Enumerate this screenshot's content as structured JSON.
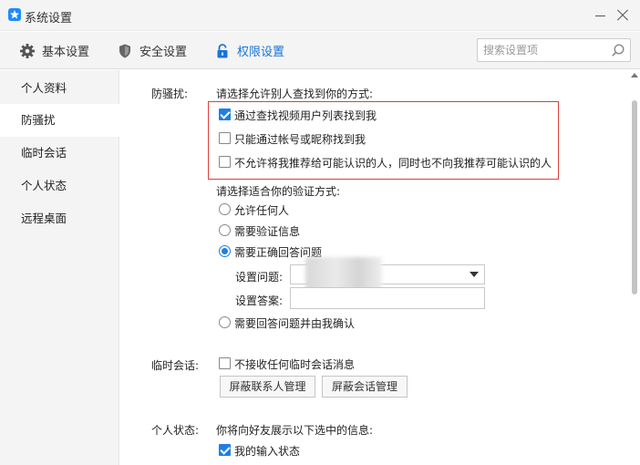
{
  "window": {
    "title": "系统设置"
  },
  "tabs": [
    {
      "label": "基本设置",
      "icon": "gear-icon"
    },
    {
      "label": "安全设置",
      "icon": "shield-icon"
    },
    {
      "label": "权限设置",
      "icon": "lock-icon",
      "active": true
    }
  ],
  "search": {
    "placeholder": "搜索设置项",
    "value": ""
  },
  "sidebar": {
    "items": [
      {
        "label": "个人资料"
      },
      {
        "label": "防骚扰",
        "active": true
      },
      {
        "label": "临时会话"
      },
      {
        "label": "个人状态"
      },
      {
        "label": "远程桌面"
      }
    ]
  },
  "anti_harass": {
    "section_label": "防骚扰:",
    "find_prompt": "请选择允许别人查找到你的方式:",
    "find_options": [
      {
        "label": "通过查找视频用户列表找到我",
        "checked": true
      },
      {
        "label": "只能通过帐号或昵称找到我",
        "checked": false
      },
      {
        "label": "不允许将我推荐给可能认识的人，同时也不向我推荐可能认识的人",
        "checked": false
      }
    ],
    "verify_prompt": "请选择适合你的验证方式:",
    "verify_options": [
      {
        "label": "允许任何人",
        "selected": false
      },
      {
        "label": "需要验证信息",
        "selected": false
      },
      {
        "label": "需要正确回答问题",
        "selected": true
      },
      {
        "label": "需要回答问题并由我确认",
        "selected": false
      }
    ],
    "question_label": "设置问题:",
    "question_value": "",
    "answer_label": "设置答案:",
    "answer_value": ""
  },
  "temp_session": {
    "section_label": "临时会话:",
    "reject_label": "不接收任何临时会话消息",
    "reject_checked": false,
    "block_contacts_btn": "屏蔽联系人管理",
    "block_sessions_btn": "屏蔽会话管理"
  },
  "personal_status": {
    "section_label": "个人状态:",
    "prompt": "你将向好友展示以下选中的信息:",
    "options": [
      {
        "label": "我的输入状态",
        "checked": true
      }
    ]
  },
  "colors": {
    "accent": "#1e7fe6",
    "highlight_border": "#d9413a",
    "active_tab_text": "#1a74d6"
  }
}
